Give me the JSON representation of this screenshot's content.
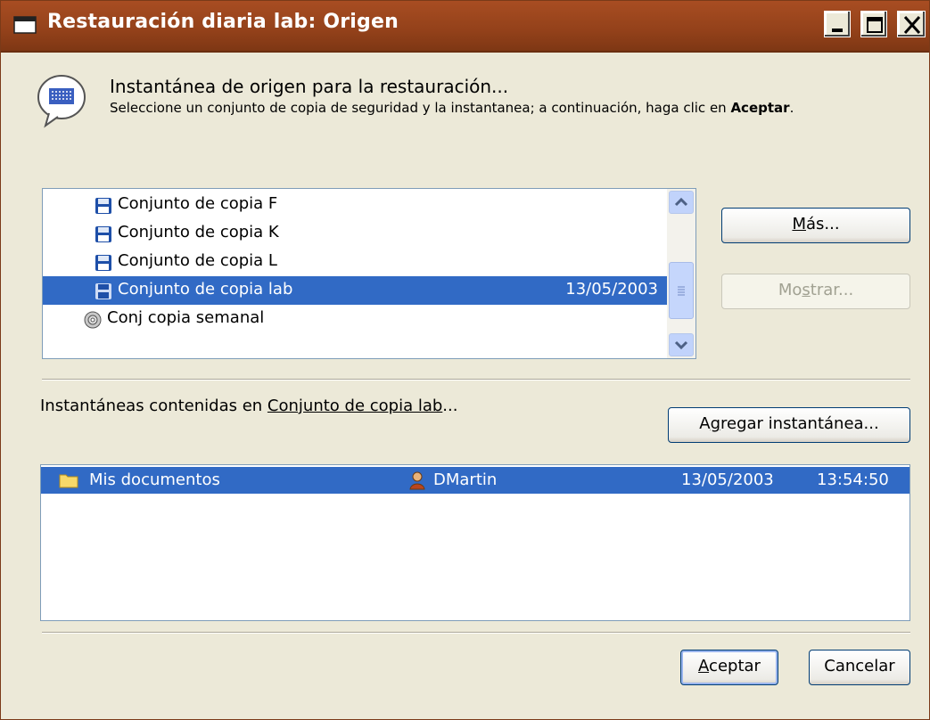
{
  "window": {
    "title": "Restauración diaria lab: Origen",
    "controls": {
      "minimize": "minimize",
      "maximize": "maximize",
      "close": "close"
    }
  },
  "header": {
    "title": "Instantánea de origen para la restauración...",
    "subtitle_prefix": "Seleccione un conjunto de copia de seguridad y la instantanea; a continuación, haga clic en ",
    "subtitle_bold": "Aceptar",
    "subtitle_suffix": "."
  },
  "backup_sets": [
    {
      "label": "Conjunto de copia F",
      "date": "",
      "icon": "floppy-disk-icon",
      "selected": false
    },
    {
      "label": "Conjunto de copia K",
      "date": "",
      "icon": "floppy-disk-icon",
      "selected": false
    },
    {
      "label": "Conjunto de copia L",
      "date": "",
      "icon": "floppy-disk-icon",
      "selected": false
    },
    {
      "label": "Conjunto de copia lab",
      "date": "13/05/2003",
      "icon": "floppy-disk-icon",
      "selected": true
    },
    {
      "label": "Conj copia semanal",
      "date": "",
      "icon": "cd-disc-icon",
      "selected": false
    }
  ],
  "buttons": {
    "mas": {
      "pre": "",
      "key": "M",
      "post": "ás..."
    },
    "mostrar": {
      "pre": "Mo",
      "key": "s",
      "post": "trar..."
    },
    "agregar": {
      "pre": "A",
      "key": "g",
      "post": "regar instantánea..."
    },
    "aceptar": {
      "pre": "",
      "key": "A",
      "post": "ceptar"
    },
    "cancelar": "Cancelar"
  },
  "snapshots_label": {
    "prefix": "Instantáneas contenidas en ",
    "link": "Conjunto de copia lab",
    "suffix": "..."
  },
  "snapshots": [
    {
      "name": "Mis documentos",
      "owner": "DMartin",
      "date": "13/05/2003",
      "time": "13:54:50",
      "selected": true
    }
  ],
  "colors": {
    "titlebar": "#93411a",
    "selection": "#316ac5",
    "dialog_bg": "#ece9d8"
  }
}
